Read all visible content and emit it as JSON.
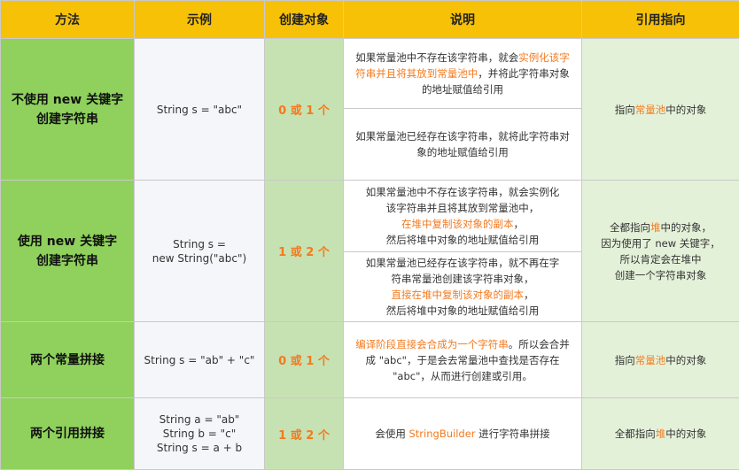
{
  "headers": {
    "method": "方法",
    "example": "示例",
    "count": "创建对象",
    "desc": "说明",
    "ref": "引用指向"
  },
  "rows": [
    {
      "method": [
        "不使用 new 关键字",
        "创建字符串"
      ],
      "example": [
        "String s = \"abc\""
      ],
      "count": "0 或 1 个",
      "desc": [
        {
          "pre": "如果常量池中不存在该字符串，就会",
          "hl": "实例化该字符串并且将其放到常量池中",
          "post": "，并将此字符串对象的地址赋值给引用"
        },
        {
          "pre": "如果常量池已经存在该字符串，就将此字符串对象的地址赋值给引用",
          "hl": "",
          "post": ""
        }
      ],
      "ref": {
        "pre": "指向",
        "hl": "常量池",
        "post": "中的对象"
      }
    },
    {
      "method": [
        "使用 new 关键字",
        "创建字符串"
      ],
      "example": [
        "String s =",
        "new String(\"abc\")"
      ],
      "count": "1 或 2 个",
      "desc": [
        {
          "l1": "如果常量池中不存在该字符串，就会实例化",
          "l2": "该字符串并且将其放到常量池中，",
          "l3": "在堆中复制该对象的副本",
          "l3post": "，",
          "l4": "然后将堆中对象的地址赋值给引用"
        },
        {
          "l1": "如果常量池已经存在该字符串，就不再在字",
          "l2": "符串常量池创建该字符串对象，",
          "l3": "直接在堆中复制该对象的副本",
          "l3post": "，",
          "l4": "然后将堆中对象的地址赋值给引用"
        }
      ],
      "ref": {
        "l1pre": "全都指向",
        "l1hl": "堆",
        "l1post": "中的对象，",
        "l2": "因为使用了 new 关键字，",
        "l3": "所以肯定会在堆中",
        "l4": "创建一个字符串对象"
      }
    },
    {
      "method": [
        "两个常量拼接"
      ],
      "example": [
        "String s =  \"ab\" + \"c\""
      ],
      "count": "0 或 1 个",
      "desc": [
        {
          "pre": "",
          "hl": "编译阶段直接会合成为一个字符串",
          "post": "。所以会合并成 \"abc\"，于是会去常量池中查找是否存在 \"abc\"，从而进行创建或引用。"
        }
      ],
      "ref": {
        "pre": "指向",
        "hl": "常量池",
        "post": "中的对象"
      }
    },
    {
      "method": [
        "两个引用拼接"
      ],
      "example": [
        "String a = \"ab\"",
        "String b = \"c\"",
        "String s = a + b"
      ],
      "count": "1 或 2 个",
      "desc": [
        {
          "pre": "会使用 ",
          "hl": "StringBuilder",
          "post": " 进行字符串拼接"
        }
      ],
      "ref": {
        "pre": "全都指向",
        "hl": "堆",
        "post": "中的对象"
      }
    }
  ],
  "colors": {
    "header": "#f7c107",
    "method": "#8fd15c",
    "count": "#c7e2b2",
    "ref": "#e4f1d9",
    "highlight": "#f37a1f"
  }
}
